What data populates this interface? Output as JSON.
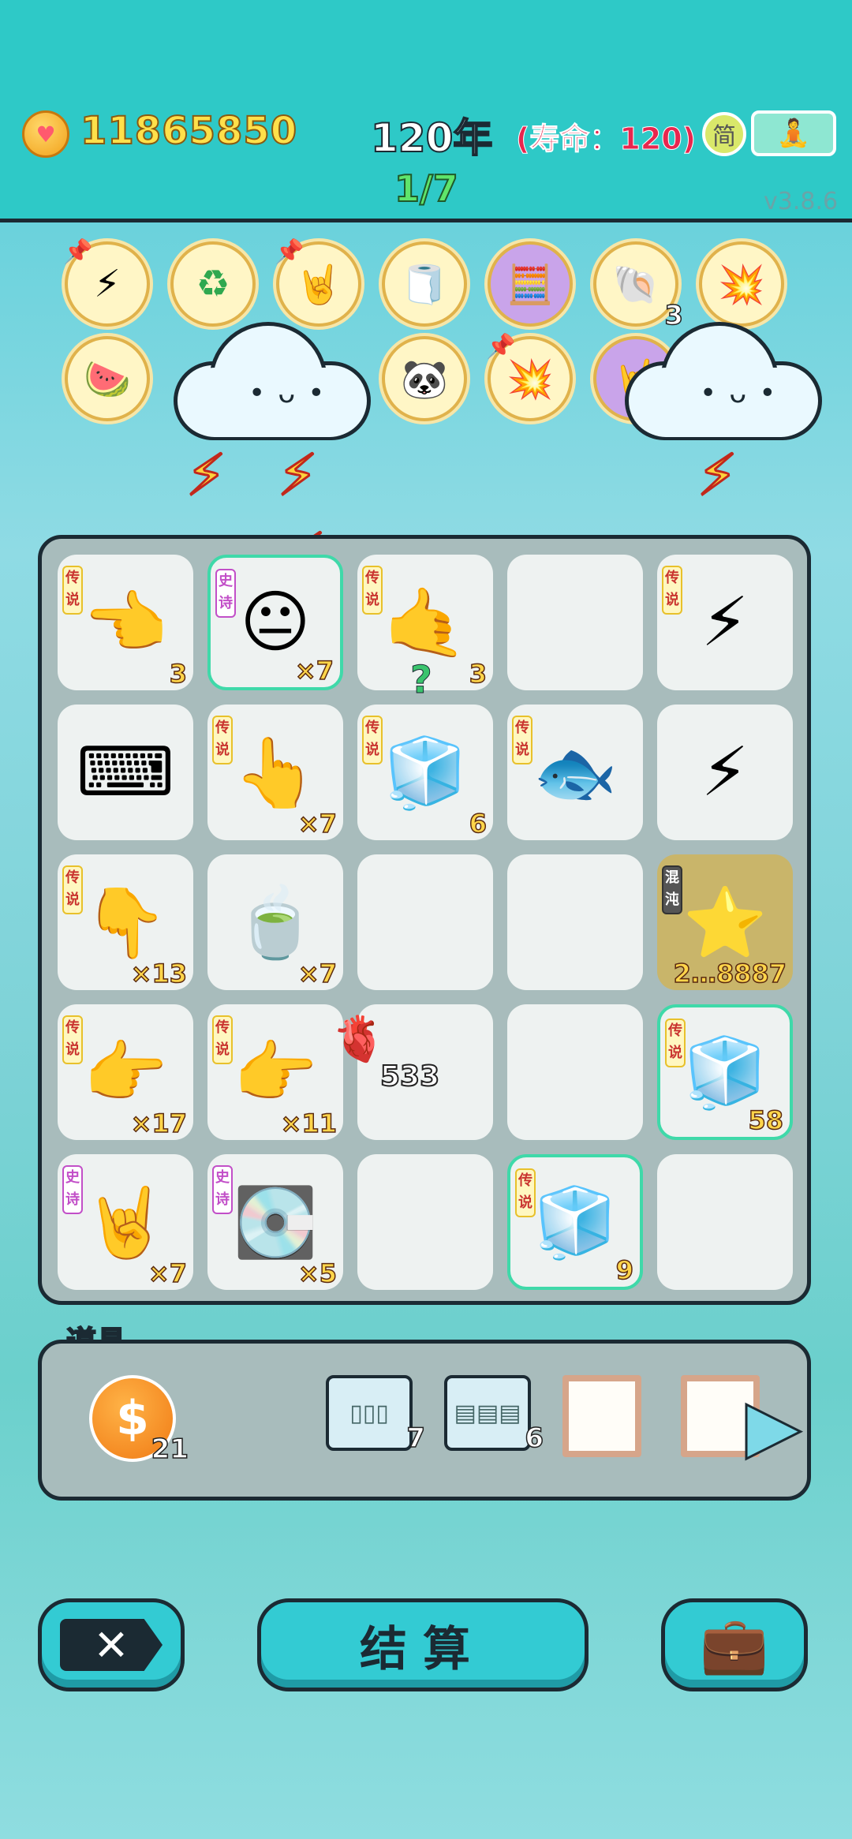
{
  "header": {
    "coins": "11865850",
    "year": "120年",
    "lifespan": "(寿命：120)",
    "stage": "1/7",
    "simplified_label": "简",
    "version": "v3.8.6"
  },
  "relics": [
    {
      "icon": "lightning-icon",
      "glyph": "⚡",
      "count": ""
    },
    {
      "icon": "recycle-icon",
      "glyph": "♻",
      "count": ""
    },
    {
      "icon": "rock-hand-icon",
      "glyph": "🤘",
      "count": ""
    },
    {
      "icon": "tissue-box-icon",
      "glyph": "🧻",
      "count": ""
    },
    {
      "icon": "math-head-icon",
      "glyph": "🧮",
      "count": ""
    },
    {
      "icon": "shell-icon",
      "glyph": "🐚",
      "count": "3"
    },
    {
      "icon": "mushroom-cloud-icon",
      "glyph": "💥",
      "count": ""
    },
    {
      "icon": "fruit-bowl-icon",
      "glyph": "🍉",
      "count": ""
    },
    {
      "icon": "panda-icon",
      "glyph": "🐼",
      "count": ""
    },
    {
      "icon": "mushroom-cloud-icon",
      "glyph": "💥",
      "count": ""
    },
    {
      "icon": "rock-hand-icon",
      "glyph": "🤘",
      "count": ""
    }
  ],
  "board": {
    "cells": [
      {
        "tag": "传说",
        "glyph": "👈",
        "count": "3"
      },
      {
        "tag": "史诗",
        "glyph": "😐",
        "count": "×7"
      },
      {
        "tag": "传说",
        "glyph": "🤙",
        "count": "3"
      },
      {
        "tag": "",
        "glyph": "",
        "count": ""
      },
      {
        "tag": "传说",
        "glyph": "⚡",
        "count": ""
      },
      {
        "tag": "",
        "glyph": "⌨",
        "count": ""
      },
      {
        "tag": "传说",
        "glyph": "👆",
        "count": "×7"
      },
      {
        "tag": "传说",
        "glyph": "🧊",
        "count": "6"
      },
      {
        "tag": "传说",
        "glyph": "🐟",
        "count": ""
      },
      {
        "tag": "",
        "glyph": "⚡",
        "count": ""
      },
      {
        "tag": "传说",
        "glyph": "👇",
        "count": "×13"
      },
      {
        "tag": "",
        "glyph": "🍵",
        "count": "×7"
      },
      {
        "tag": "",
        "glyph": "",
        "count": ""
      },
      {
        "tag": "",
        "glyph": "",
        "count": ""
      },
      {
        "tag": "混沌",
        "glyph": "⭐",
        "count": "2…8887"
      },
      {
        "tag": "传说",
        "glyph": "👉",
        "count": "×17"
      },
      {
        "tag": "传说",
        "glyph": "👉",
        "count": "×11"
      },
      {
        "tag": "",
        "glyph": "",
        "count": ""
      },
      {
        "tag": "",
        "glyph": "",
        "count": ""
      },
      {
        "tag": "传说",
        "glyph": "🧊",
        "count": "58"
      },
      {
        "tag": "史诗",
        "glyph": "🤘",
        "count": "×7"
      },
      {
        "tag": "史诗",
        "glyph": "💽",
        "count": "×5"
      },
      {
        "tag": "",
        "glyph": "",
        "count": ""
      },
      {
        "tag": "传说",
        "glyph": "🧊",
        "count": "9"
      },
      {
        "tag": "",
        "glyph": "",
        "count": ""
      }
    ],
    "question_mark": "?",
    "floating_item_count": "533"
  },
  "props": {
    "label": "道具",
    "items": [
      {
        "name": "coin-item",
        "glyph": "$",
        "count": "21"
      },
      {
        "name": "shelf-item",
        "glyph": "▯▯▯",
        "count": "7"
      },
      {
        "name": "box-shelf-item",
        "glyph": "▤▤▤",
        "count": "6"
      },
      {
        "name": "frame-item",
        "glyph": "",
        "count": ""
      },
      {
        "name": "frame-item",
        "glyph": "",
        "count": ""
      }
    ],
    "next_label": "▶"
  },
  "buttons": {
    "exit_label": "✕",
    "settle_label": "结算",
    "bag_glyph": "💼"
  }
}
